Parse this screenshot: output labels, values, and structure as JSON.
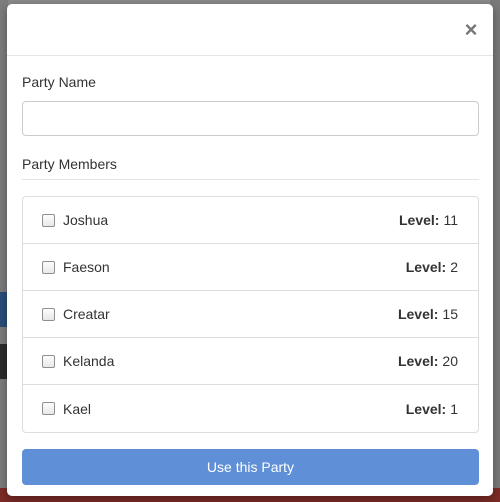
{
  "modal": {
    "close_glyph": "×",
    "party_name_label": "Party Name",
    "party_name_value": "",
    "party_members_label": "Party Members",
    "level_label": "Level:",
    "members": [
      {
        "name": "Joshua",
        "level": "11",
        "checked": false
      },
      {
        "name": "Faeson",
        "level": "2",
        "checked": false
      },
      {
        "name": "Creatar",
        "level": "15",
        "checked": false
      },
      {
        "name": "Kelanda",
        "level": "20",
        "checked": false
      },
      {
        "name": "Kael",
        "level": "1",
        "checked": false
      }
    ],
    "submit_label": "Use this Party"
  },
  "colors": {
    "primary_button": "#5f8fd6",
    "backdrop": "#5f5f5f"
  }
}
